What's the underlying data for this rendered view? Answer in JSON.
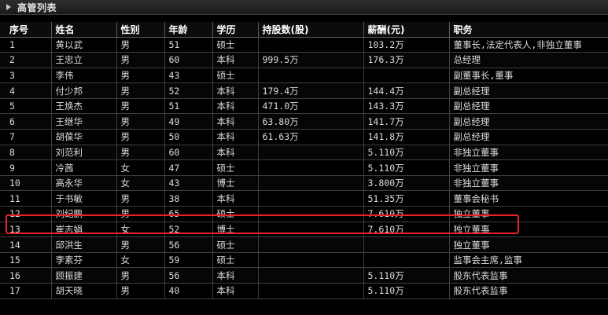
{
  "panel": {
    "title": "高管列表"
  },
  "table": {
    "headers": [
      "序号",
      "姓名",
      "性别",
      "年龄",
      "学历",
      "持股数(股)",
      "薪酬(元)",
      "职务"
    ],
    "rows": [
      [
        "1",
        "黄以武",
        "男",
        "51",
        "硕士",
        "",
        "103.2万",
        "董事长,法定代表人,非独立董事"
      ],
      [
        "2",
        "王忠立",
        "男",
        "60",
        "本科",
        "999.5万",
        "176.3万",
        "总经理"
      ],
      [
        "3",
        "李伟",
        "男",
        "43",
        "硕士",
        "",
        "",
        "副董事长,董事"
      ],
      [
        "4",
        "付少邦",
        "男",
        "52",
        "本科",
        "179.4万",
        "144.4万",
        "副总经理"
      ],
      [
        "5",
        "王焕杰",
        "男",
        "51",
        "本科",
        "471.0万",
        "143.3万",
        "副总经理"
      ],
      [
        "6",
        "王继华",
        "男",
        "49",
        "本科",
        "63.80万",
        "141.7万",
        "副总经理"
      ],
      [
        "7",
        "胡葆华",
        "男",
        "50",
        "本科",
        "61.63万",
        "141.8万",
        "副总经理"
      ],
      [
        "8",
        "刘范利",
        "男",
        "60",
        "本科",
        "",
        "5.110万",
        "非独立董事"
      ],
      [
        "9",
        "冷茜",
        "女",
        "47",
        "硕士",
        "",
        "5.110万",
        "非独立董事"
      ],
      [
        "10",
        "高永华",
        "女",
        "43",
        "博士",
        "",
        "3.800万",
        "非独立董事"
      ],
      [
        "11",
        "于书敏",
        "男",
        "38",
        "本科",
        "",
        "51.35万",
        "董事会秘书"
      ],
      [
        "12",
        "刘纪鹏",
        "男",
        "65",
        "硕士",
        "",
        "7.610万",
        "独立董事"
      ],
      [
        "13",
        "崔志娟",
        "女",
        "52",
        "博士",
        "",
        "7.610万",
        "独立董事"
      ],
      [
        "14",
        "邱洪生",
        "男",
        "56",
        "硕士",
        "",
        "",
        "独立董事"
      ],
      [
        "15",
        "李素芬",
        "女",
        "59",
        "硕士",
        "",
        "",
        "监事会主席,监事"
      ],
      [
        "16",
        "顾振建",
        "男",
        "56",
        "本科",
        "",
        "5.110万",
        "股东代表监事"
      ],
      [
        "17",
        "胡天晓",
        "男",
        "40",
        "本科",
        "",
        "5.110万",
        "股东代表监事"
      ]
    ],
    "highlighted_row_number": "12",
    "highlight_color": "#e8222b"
  }
}
